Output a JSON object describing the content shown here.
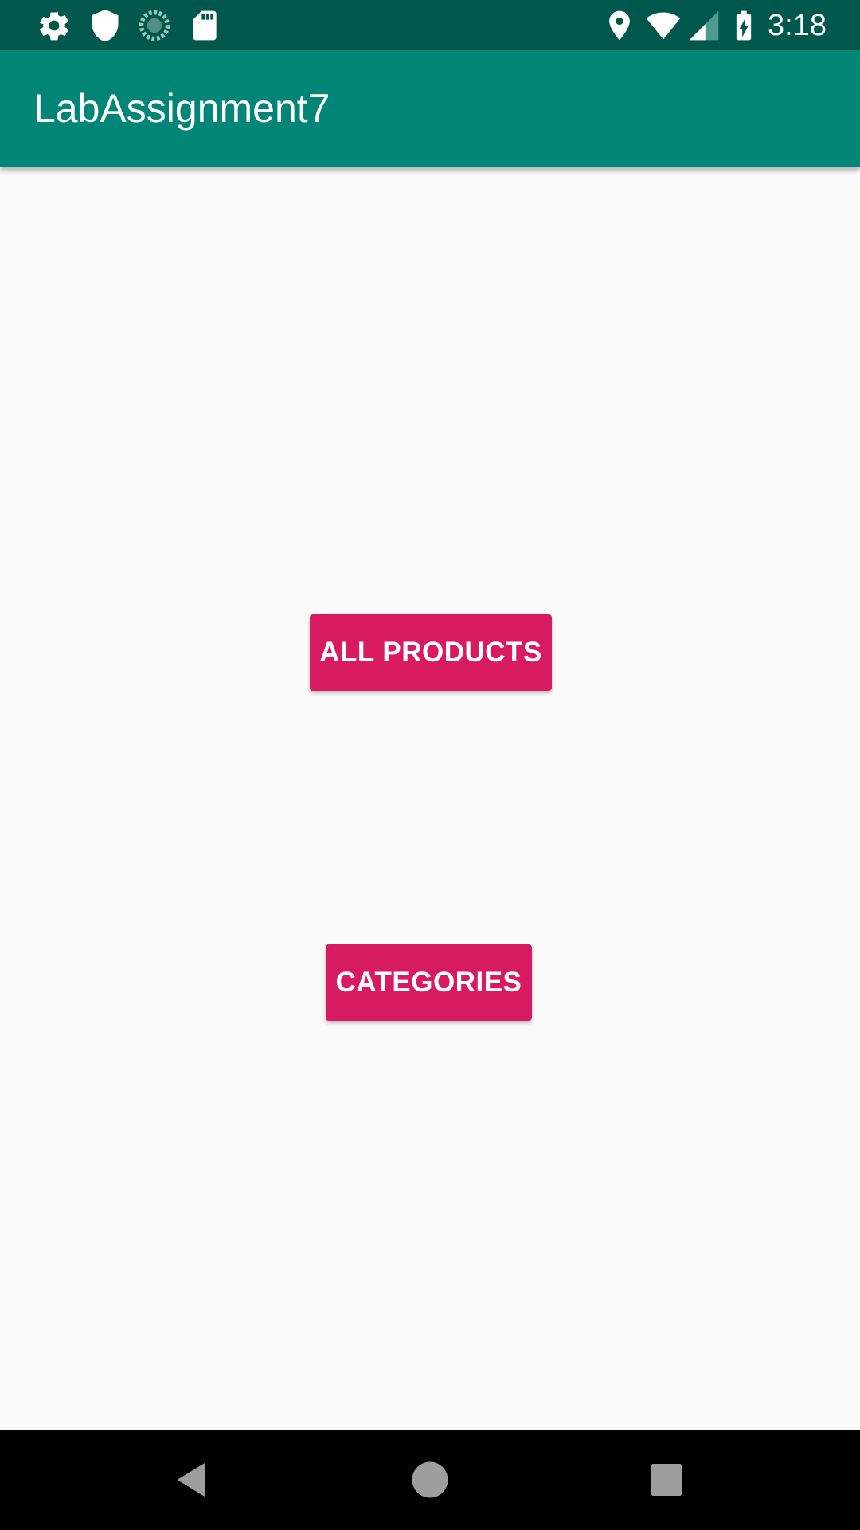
{
  "status_bar": {
    "time": "3:18",
    "left_icons": [
      "settings-icon",
      "shield-icon",
      "sync-icon",
      "sd-card-icon"
    ],
    "right_icons": [
      "location-icon",
      "wifi-icon",
      "signal-icon",
      "battery-charging-icon"
    ],
    "color": "#00574b"
  },
  "app_bar": {
    "title": "LabAssignment7",
    "color": "#008577"
  },
  "main": {
    "buttons": [
      {
        "label": "ALL PRODUCTS"
      },
      {
        "label": "CATEGORIES"
      }
    ],
    "button_color": "#d81b60",
    "background": "#fafafa"
  },
  "nav_bar": {
    "buttons": [
      "back-icon",
      "home-icon",
      "recents-icon"
    ]
  }
}
